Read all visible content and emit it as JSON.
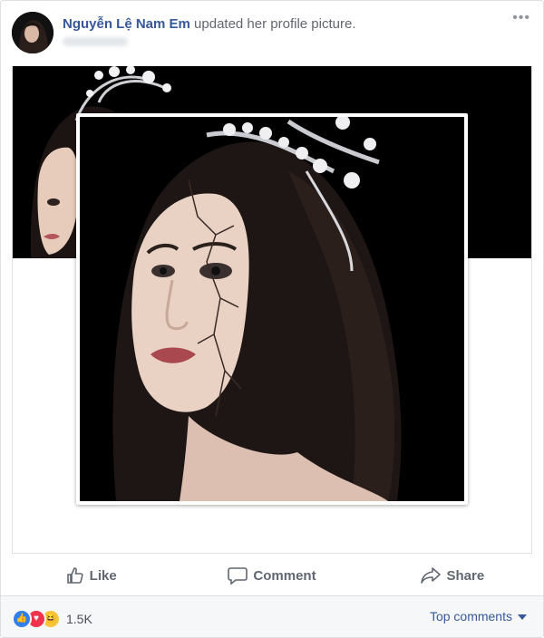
{
  "post": {
    "author": "Nguyễn Lệ Nam Em",
    "action_text": "updated her profile picture.",
    "more_icon": "ellipsis-icon"
  },
  "actions": {
    "like": "Like",
    "comment": "Comment",
    "share": "Share"
  },
  "footer": {
    "reaction_icons": [
      "like-reaction-icon",
      "love-reaction-icon",
      "haha-reaction-icon"
    ],
    "reaction_count": "1.5K",
    "sort_label": "Top comments"
  },
  "colors": {
    "link": "#365899",
    "action_text": "#616770",
    "like": "#2f80ed",
    "love": "#f0334c",
    "haha": "#f7c53c"
  }
}
